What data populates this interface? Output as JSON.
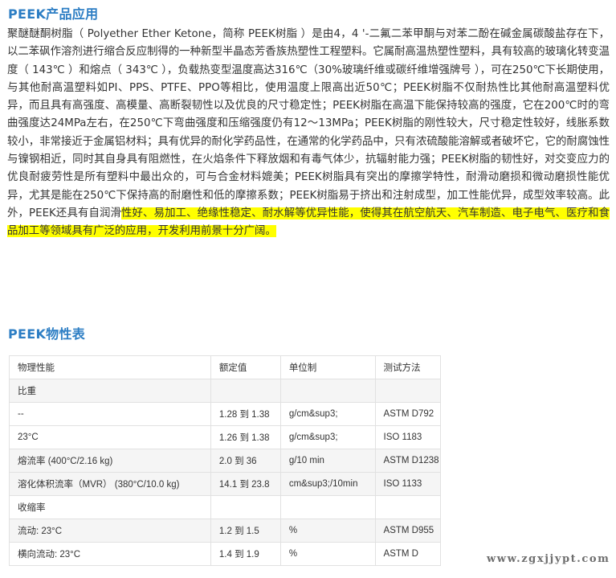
{
  "colors": {
    "heading": "#2d7ec4",
    "highlight": "#ffff00",
    "text": "#333333",
    "row_shade": "#f5f5f5"
  },
  "section1": {
    "title": "PEEK产品应用",
    "paragraph": "聚醚醚酮树脂（ Polyether Ether Ketone，简称 PEEK树脂 ）是由4，4 '-二氟二苯甲酮与对苯二酚在碱金属碳酸盐存在下，以二苯砜作溶剂进行缩合反应制得的一种新型半晶态芳香族热塑性工程塑料。它属耐高温热塑性塑料，具有较高的玻璃化转变温度（ 143℃ ）和熔点（ 343℃ ），负载热变型温度高达316℃（30%玻璃纤维或碳纤维增强牌号 ），可在250℃下长期使用，与其他耐高温塑料如PI、PPS、PTFE、PPO等相比，使用温度上限高出近50℃；PEEK树脂不仅耐热性比其他耐高温塑料优异，而且具有高强度、高模量、高断裂韧性以及优良的尺寸稳定性；PEEK树脂在高温下能保持较高的强度，它在200℃时的弯曲强度达24MPa左右，在250℃下弯曲强度和压缩强度仍有12～13MPa；PEEK树脂的刚性较大，尺寸稳定性较好，线胀系数较小，非常接近于金属铝材料；具有优异的耐化学药品性，在通常的化学药品中，只有浓硫酸能溶解或者破坏它，它的耐腐蚀性与镍钢相近，同时其自身具有阻燃性，在火焰条件下释放烟和有毒气体少，抗辐射能力强；PEEK树脂的韧性好，对交变应力的优良耐疲劳性是所有塑料中最出众的，可与合金材料媲美；PEEK树脂具有突出的摩擦学特性，耐滑动磨损和微动磨损性能优异，尤其是能在250℃下保持高的耐磨性和低的摩擦系数；PEEK树脂易于挤出和注射成型，加工性能优异，成型效率较高。此外，PEEK还具有自润滑",
    "highlighted": "性好、易加工、绝缘性稳定、耐水解等优异性能，使得其在航空航天、汽车制造、电子电气、医疗和食品加工等领域具有广泛的应用，开发利用前景十分广阔。"
  },
  "section2": {
    "title": "PEEK物性表",
    "headers": [
      "物理性能",
      "额定值",
      "单位制",
      "测试方法"
    ],
    "rows": [
      [
        "比重",
        "",
        "",
        ""
      ],
      [
        "--",
        "1.28 到 1.38",
        "g/cm&sup3;",
        "ASTM D792"
      ],
      [
        "23°C",
        "1.26 到 1.38",
        "g/cm&sup3;",
        "ISO 1183"
      ],
      [
        "熔流率 (400°C/2.16 kg)",
        "2.0 到 36",
        "g/10 min",
        "ASTM D1238"
      ],
      [
        "溶化体积流率（MVR） (380°C/10.0 kg)",
        "14.1 到 23.8",
        "cm&sup3;/10min",
        "ISO 1133"
      ],
      [
        "收缩率",
        "",
        "",
        ""
      ],
      [
        "流动: 23°C",
        "1.2 到 1.5",
        "%",
        "ASTM D955"
      ],
      [
        "横向流动: 23°C",
        "1.4 到 1.9",
        "%",
        "ASTM D"
      ]
    ]
  },
  "watermark": "www.zgxjjypt.com"
}
